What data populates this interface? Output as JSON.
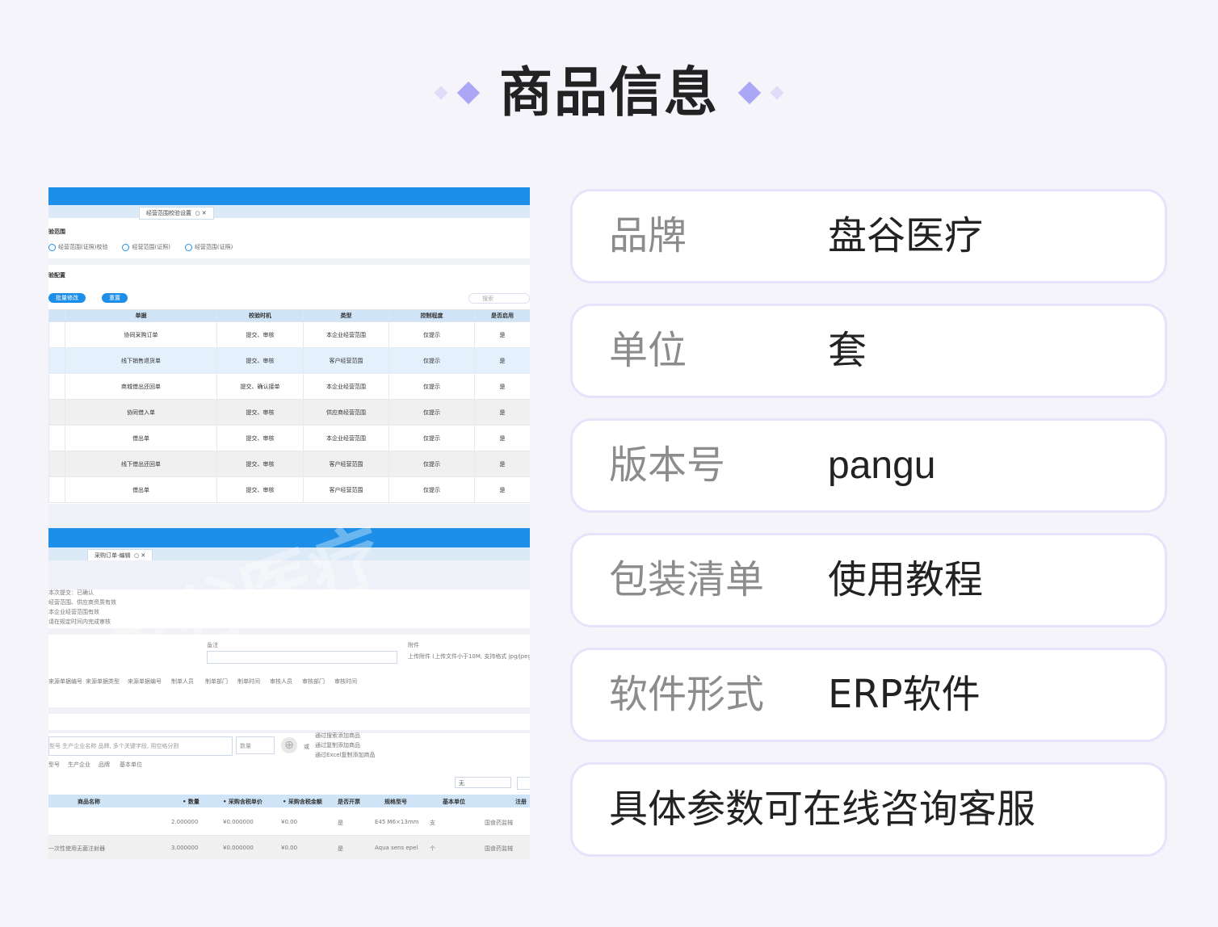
{
  "title": "商品信息",
  "info": [
    {
      "label": "品牌",
      "value": "盘谷医疗"
    },
    {
      "label": "单位",
      "value": "套"
    },
    {
      "label": "版本号",
      "value": "pangu"
    },
    {
      "label": "包装清单",
      "value": "使用教程"
    },
    {
      "label": "软件形式",
      "value": "ERP软件"
    }
  ],
  "note": "具体参数可在线咨询客服",
  "screenshot": {
    "tab1": "经营范围校验设置",
    "section1": "验范围",
    "radios": [
      "经营范围(证照)校验",
      "经营范围(证照)",
      "经营范围(证照)"
    ],
    "section2": "验配置",
    "buttons": [
      "批量修改",
      "重置"
    ],
    "search_placeholder": "搜索",
    "headers": [
      "单据",
      "校验时机",
      "类型",
      "控制程度",
      "是否启用"
    ],
    "rows": [
      [
        "协同采购订单",
        "提交、审核",
        "本企业经营范围",
        "仅提示",
        "是"
      ],
      [
        "线下销售退货单",
        "提交、审核",
        "客户经营范围",
        "仅提示",
        "是"
      ],
      [
        "商城借出还回单",
        "提交、确认接单",
        "本企业经营范围",
        "仅提示",
        "是"
      ],
      [
        "协同借入单",
        "提交、审核",
        "供应商经营范围",
        "仅提示",
        "是"
      ],
      [
        "借出单",
        "提交、审核",
        "本企业经营范围",
        "仅提示",
        "是"
      ],
      [
        "线下借出还回单",
        "提交、审核",
        "客户经营范围",
        "仅提示",
        "是"
      ],
      [
        "借出单",
        "提交、审核",
        "客户经营范围",
        "仅提示",
        "是"
      ]
    ],
    "tab2": "采购订单-编辑",
    "warnings": [
      "本次提交：已确认",
      "经营范围、供应商资质有效",
      "本企业经营范围有效",
      "请在规定时间内完成审核"
    ],
    "remark_label": "备注",
    "attach_label": "附件",
    "attach_hint": "上传附件 (上传文件小于10M, 支持格式 jpg/jpeg)",
    "meta_headers": [
      "来源单据编号",
      "来源单据类型",
      "来源单据编号",
      "制单人员",
      "制单部门",
      "制单时间",
      "审核人员",
      "审核部门",
      "审核时间"
    ],
    "product_search": "型号 生产企业名称 品牌, 多个关键字段, 用空格分割",
    "qty_label": "数量",
    "add_hints": [
      "通过搜索添加商品",
      "通过复制添加商品",
      "通过Excel复制添加商品"
    ],
    "small_cols": [
      "型号",
      "生产企业",
      "品牌",
      "基本单位"
    ],
    "select_value": "无",
    "grid2_headers": [
      "商品名称",
      "• 数量",
      "• 采购含税单价",
      "• 采购含税金额",
      "是否开票",
      "规格型号",
      "基本单位",
      "注册"
    ],
    "grid2_rows": [
      [
        "",
        "2.000000",
        "¥0.000000",
        "¥0.00",
        "是",
        "E45 M6×13mm",
        "支",
        "国食药监械"
      ],
      [
        "一次性使用无菌注射器",
        "3.000000",
        "¥0.000000",
        "¥0.00",
        "是",
        "Aqua sens epel",
        "个",
        "国食药监械"
      ]
    ],
    "watermark": "盘谷医疗"
  }
}
